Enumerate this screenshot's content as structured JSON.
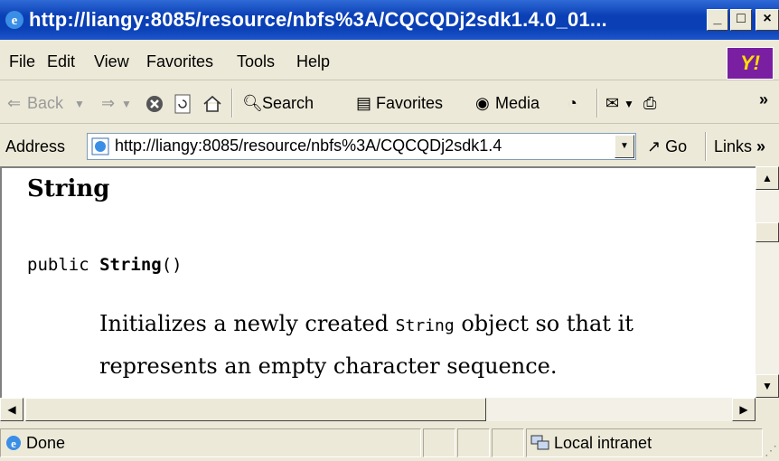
{
  "window": {
    "title": "http://liangy:8085/resource/nbfs%3A/CQCQDj2sdk1.4.0_01...",
    "minimize": "_",
    "maximize": "□",
    "close": "×"
  },
  "menu": [
    "File",
    "Edit",
    "View",
    "Favorites",
    "Tools",
    "Help"
  ],
  "toolbar": {
    "back": "Back",
    "search": "Search",
    "favorites": "Favorites",
    "media": "Media",
    "more": "»"
  },
  "address": {
    "label": "Address",
    "url": "http://liangy:8085/resource/nbfs%3A/CQCQDj2sdk1.4",
    "go": "Go",
    "links": "Links",
    "more": "»"
  },
  "content": {
    "heading": "String",
    "sig_prefix": "public ",
    "sig_name": "String",
    "sig_suffix": "()",
    "desc_pre": "Initializes a newly created ",
    "desc_code": "String",
    "desc_post": " object so that it represents an empty character sequence."
  },
  "status": {
    "left": "Done",
    "zone": "Local intranet"
  },
  "colors": {
    "titlebar": "#0a3fb5",
    "chrome": "#ece9d8"
  }
}
